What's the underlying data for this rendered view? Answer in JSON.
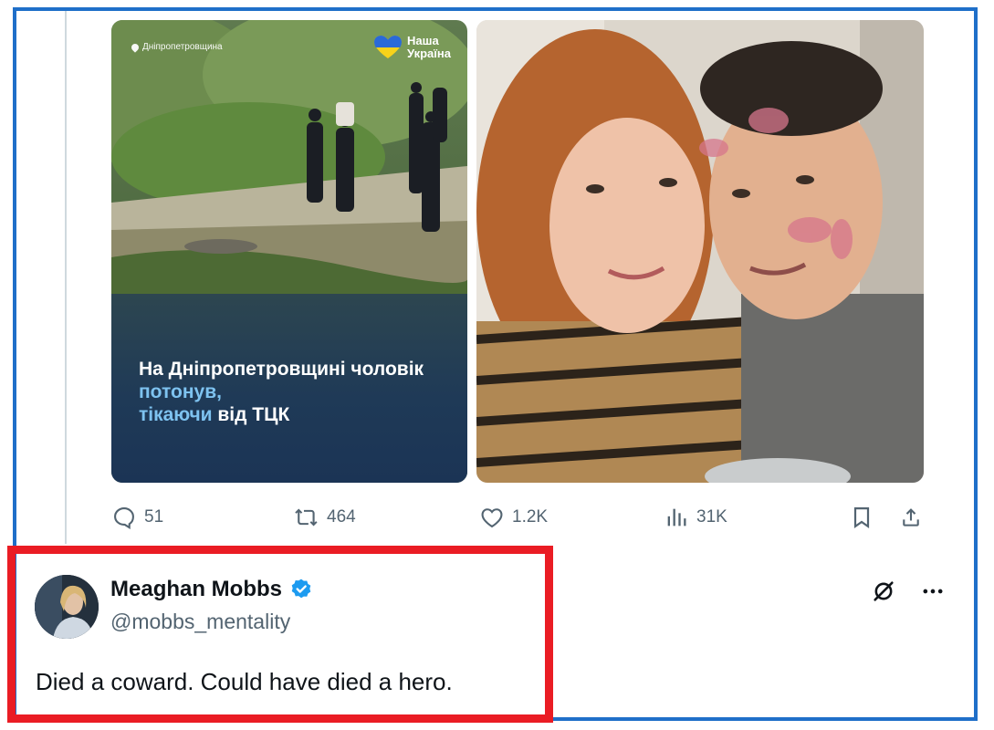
{
  "post": {
    "left_image": {
      "location": "Дніпропетровщина",
      "brand_line1": "Наша",
      "brand_line2": "Україна",
      "headline_part1": "На Дніпропетровщині чоловік ",
      "headline_accent1": "потонув,",
      "headline_accent2": "тікаючи",
      "headline_part2": " від ТЦК"
    },
    "actions": {
      "replies": "51",
      "reposts": "464",
      "likes": "1.2K",
      "views": "31K"
    }
  },
  "reply": {
    "author_name": "Meaghan Mobbs",
    "handle": "@mobbs_mentality",
    "text": "Died a coward. Could have died a hero."
  },
  "colors": {
    "frame_border": "#1f6fc9",
    "highlight_border": "#ea1c24",
    "verified_badge": "#1d9bf0",
    "headline_accent": "#7ec3f0",
    "muted_text": "#536471"
  }
}
